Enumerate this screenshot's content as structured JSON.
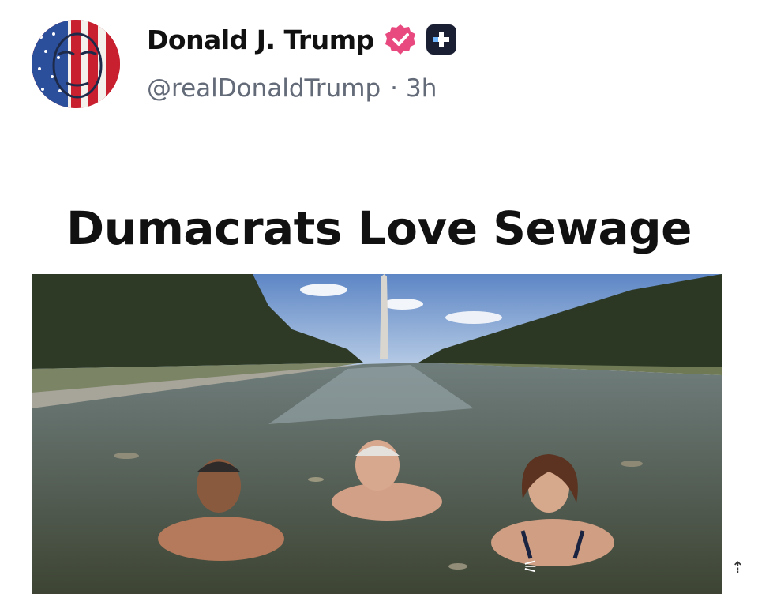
{
  "post": {
    "author_name": "Donald J. Trump",
    "handle": "@realDonaldTrump",
    "separator": "·",
    "time": "3h",
    "verified_icon": "verified-badge-icon",
    "plus_icon": "plus-badge-icon"
  },
  "headline": "Dumacrats Love Sewage",
  "colors": {
    "verified": "#e84a7f",
    "plus_badge": "#1a1f33",
    "handle": "#636a78"
  }
}
